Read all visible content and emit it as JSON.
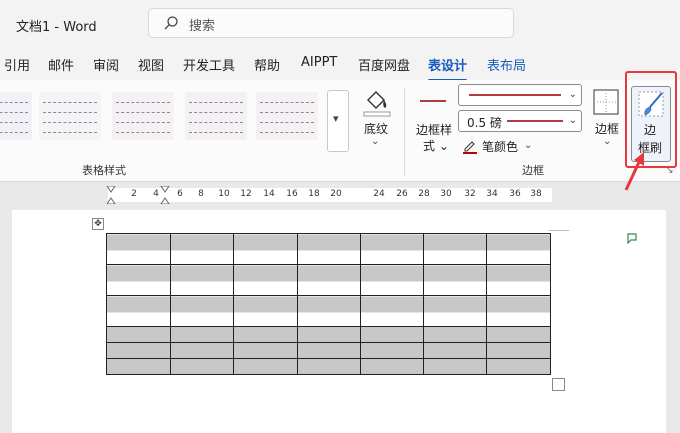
{
  "titlebar": {
    "doc_title": "文档1  -  Word",
    "search_placeholder": "搜索"
  },
  "tabs": [
    {
      "label": "引用",
      "state": "normal"
    },
    {
      "label": "邮件",
      "state": "normal"
    },
    {
      "label": "审阅",
      "state": "normal"
    },
    {
      "label": "视图",
      "state": "normal"
    },
    {
      "label": "开发工具",
      "state": "normal"
    },
    {
      "label": "帮助",
      "state": "normal"
    },
    {
      "label": "AIPPT",
      "state": "normal"
    },
    {
      "label": "百度网盘",
      "state": "normal"
    },
    {
      "label": "表设计",
      "state": "active"
    },
    {
      "label": "表布局",
      "state": "contextual"
    }
  ],
  "ribbon": {
    "table_styles_group": "表格样式",
    "shading": {
      "label": "底纹",
      "caret": "⌄"
    },
    "borders_group": "边框",
    "border_styles": {
      "line1": "边框样",
      "line2": "式 ⌄"
    },
    "line_weight": "0.5 磅",
    "pen_color": {
      "label": "笔颜色",
      "caret": "⌄"
    },
    "borders": {
      "label": "边框",
      "caret": "⌄"
    },
    "border_painter": {
      "line1": "边",
      "line2": "框刷"
    },
    "dialog_launcher": "↘"
  },
  "ruler": {
    "ticks": [
      "2",
      "4",
      "6",
      "8",
      "10",
      "12",
      "14",
      "16",
      "18",
      "20",
      "24",
      "26",
      "28",
      "30",
      "32",
      "34",
      "36",
      "38"
    ]
  },
  "colors": {
    "accent": "#185abd",
    "highlight": "#e8373f",
    "border_red": "#b23b3b",
    "shade": "#c8c8c8"
  }
}
